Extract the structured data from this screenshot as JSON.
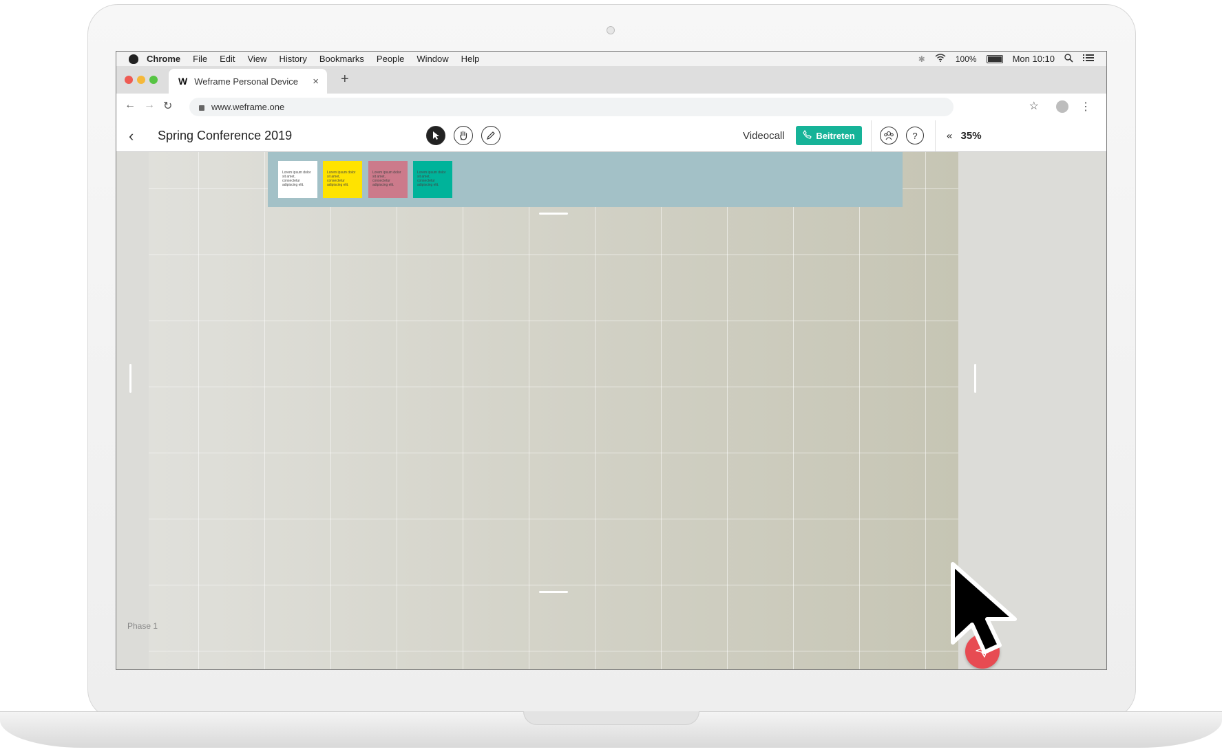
{
  "menubar": {
    "app": "Chrome",
    "items": [
      "File",
      "Edit",
      "View",
      "History",
      "Bookmarks",
      "People",
      "Window",
      "Help"
    ],
    "battery": "100%",
    "clock": "Mon 10:10"
  },
  "tab": {
    "logo": "W",
    "title": "Weframe Personal Device",
    "close": "×",
    "new": "+"
  },
  "address": {
    "url": "www.weframe.one"
  },
  "toolbar": {
    "title": "Spring Conference 2019",
    "videocall_label": "Videocall",
    "join_label": "Beitreten",
    "help": "?",
    "zoom": "35%",
    "zoom_collapse": "«"
  },
  "notes": [
    {
      "text": "Lorem ipsum dolor sit amet, consectetur adipiscing elit.",
      "color": "#ffffff"
    },
    {
      "text": "Lorem ipsum dolor sit amet, consectetur adipiscing elit.",
      "color": "#ffe300"
    },
    {
      "text": "Lorem ipsum dolor sit amet, consectetur adipiscing elit.",
      "color": "#cc7a8b"
    },
    {
      "text": "Lorem ipsum dolor sit amet, consectetur adipiscing elit.",
      "color": "#00b39a"
    }
  ],
  "phase_label": "Phase 1",
  "colors": {
    "accent": "#16b398",
    "fab": "#e74b52",
    "parking": "#a3c1c7"
  }
}
